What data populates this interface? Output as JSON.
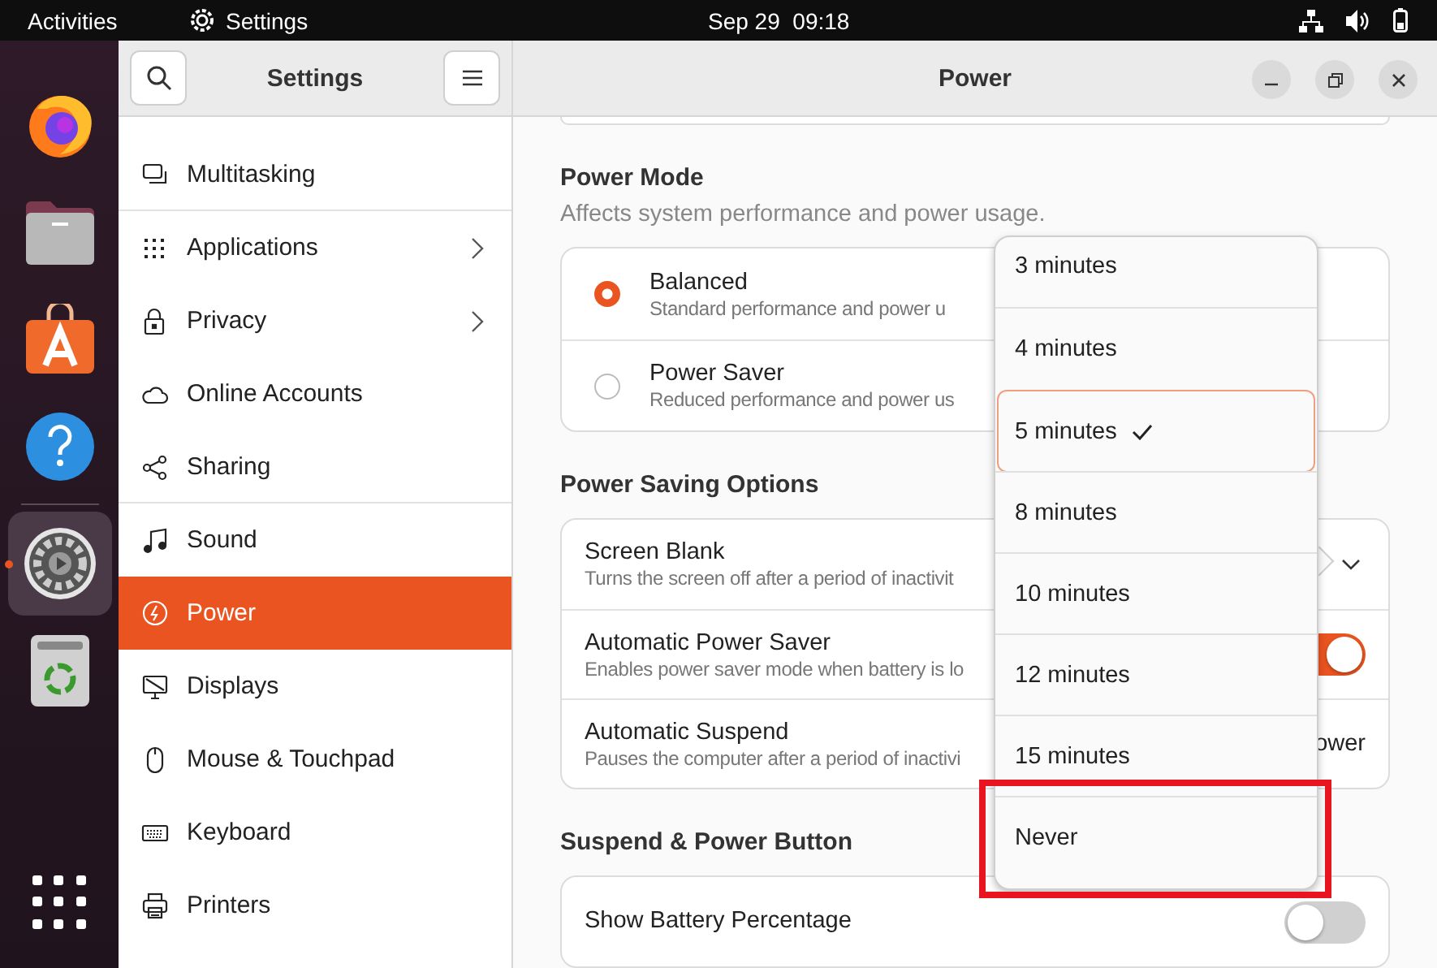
{
  "top_bar": {
    "activities": "Activities",
    "app_name": "Settings",
    "clock": "Sep 29  09:18"
  },
  "dock": {
    "items": [
      {
        "kind": "browser",
        "active": false
      },
      {
        "kind": "files",
        "active": false
      },
      {
        "kind": "software",
        "active": false
      },
      {
        "kind": "help",
        "active": false
      },
      {
        "kind": "settings",
        "active": true
      },
      {
        "kind": "trash",
        "active": false
      }
    ]
  },
  "window": {
    "sidebar_title": "Settings",
    "title": "Power"
  },
  "sidebar": {
    "items": [
      {
        "kind": "multitasking",
        "label": "Multitasking",
        "arrow": false,
        "selected": false,
        "group_end": true
      },
      {
        "kind": "applications",
        "label": "Applications",
        "arrow": true,
        "selected": false,
        "group_end": false
      },
      {
        "kind": "privacy",
        "label": "Privacy",
        "arrow": true,
        "selected": false,
        "group_end": false
      },
      {
        "kind": "online",
        "label": "Online Accounts",
        "arrow": false,
        "selected": false,
        "group_end": false
      },
      {
        "kind": "sharing",
        "label": "Sharing",
        "arrow": false,
        "selected": false,
        "group_end": true
      },
      {
        "kind": "sound",
        "label": "Sound",
        "arrow": false,
        "selected": false,
        "group_end": false
      },
      {
        "kind": "power",
        "label": "Power",
        "arrow": false,
        "selected": true,
        "group_end": false
      },
      {
        "kind": "displays",
        "label": "Displays",
        "arrow": false,
        "selected": false,
        "group_end": false
      },
      {
        "kind": "mouse",
        "label": "Mouse & Touchpad",
        "arrow": false,
        "selected": false,
        "group_end": false
      },
      {
        "kind": "keyboard",
        "label": "Keyboard",
        "arrow": false,
        "selected": false,
        "group_end": false
      },
      {
        "kind": "printers",
        "label": "Printers",
        "arrow": false,
        "selected": false,
        "group_end": false
      }
    ]
  },
  "sections": [
    {
      "heading": "Power Mode",
      "subtitle": "Affects system performance and power usage.",
      "rows": [
        {
          "kind": "radio",
          "title": "Balanced",
          "subtitle": "Standard performance and power u",
          "selected": true
        },
        {
          "kind": "radio",
          "title": "Power Saver",
          "subtitle": "Reduced performance and power us",
          "selected": false
        }
      ]
    },
    {
      "heading": "Power Saving Options",
      "rows": [
        {
          "kind": "dropdown",
          "title": "Screen Blank",
          "subtitle": "Turns the screen off after a period of inactivit"
        },
        {
          "kind": "switch",
          "title": "Automatic Power Saver",
          "subtitle": "Enables power saver mode when battery is lo",
          "on": true
        },
        {
          "kind": "value",
          "title": "Automatic Suspend",
          "subtitle": "Pauses the computer after a period of inactivi",
          "value": "ower"
        }
      ]
    },
    {
      "heading": "Suspend & Power Button",
      "rows": [
        {
          "kind": "switch",
          "title": "Show Battery Percentage",
          "on": false
        }
      ]
    }
  ],
  "popover": {
    "options": [
      {
        "label": "3 minutes",
        "selected": false,
        "highlighted": false
      },
      {
        "label": "4 minutes",
        "selected": false,
        "highlighted": false
      },
      {
        "label": "5 minutes",
        "selected": true,
        "highlighted": false
      },
      {
        "label": "8 minutes",
        "selected": false,
        "highlighted": false
      },
      {
        "label": "10 minutes",
        "selected": false,
        "highlighted": false
      },
      {
        "label": "12 minutes",
        "selected": false,
        "highlighted": false
      },
      {
        "label": "15 minutes",
        "selected": false,
        "highlighted": false
      },
      {
        "label": "Never",
        "selected": false,
        "highlighted": true
      }
    ]
  }
}
